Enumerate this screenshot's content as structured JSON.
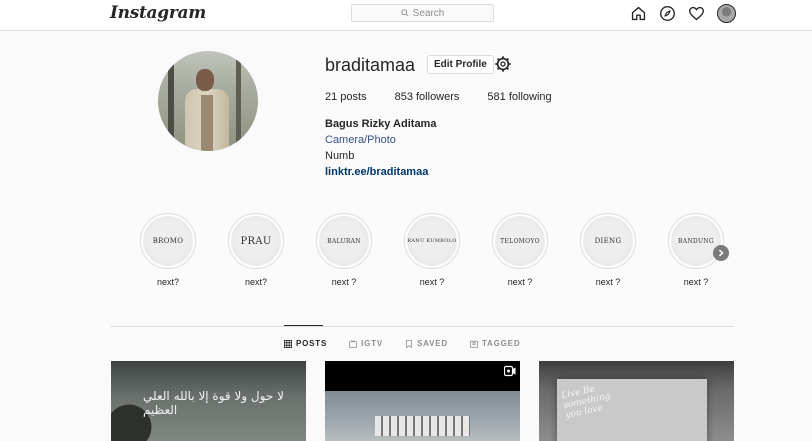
{
  "nav": {
    "logo": "Instagram",
    "search_placeholder": "Search"
  },
  "profile": {
    "username": "braditamaa",
    "edit_button": "Edit Profile",
    "stats": {
      "posts": "21 posts",
      "followers": "853 followers",
      "following": "581 following"
    },
    "bio": {
      "full_name": "Bagus Rizky Aditama",
      "category": "Camera/Photo",
      "text": "Numb",
      "link": "linktr.ee/braditamaa"
    }
  },
  "highlights": [
    {
      "cover": "BROMO",
      "label": "next?"
    },
    {
      "cover": "PRAU",
      "label": "next?"
    },
    {
      "cover": "BALURAN",
      "label": "next ?"
    },
    {
      "cover": "RANU KUMBOLO",
      "label": "next ?"
    },
    {
      "cover": "TELOMOYO",
      "label": "next ?"
    },
    {
      "cover": "DIENG",
      "label": "next ?"
    },
    {
      "cover": "BANDUNG",
      "label": "next ?"
    }
  ],
  "tabs": [
    {
      "label": "POSTS",
      "icon": "grid-icon",
      "active": true
    },
    {
      "label": "IGTV",
      "icon": "igtv-icon",
      "active": false
    },
    {
      "label": "SAVED",
      "icon": "bookmark-icon",
      "active": false
    },
    {
      "label": "TAGGED",
      "icon": "tag-icon",
      "active": false
    }
  ],
  "posts": [
    {
      "overlay_text": "لا حول ولا قوة إلا بالله العلي العظيم"
    },
    {
      "overlay_text": ""
    },
    {
      "overlay_text": "Live Be something you love"
    }
  ]
}
